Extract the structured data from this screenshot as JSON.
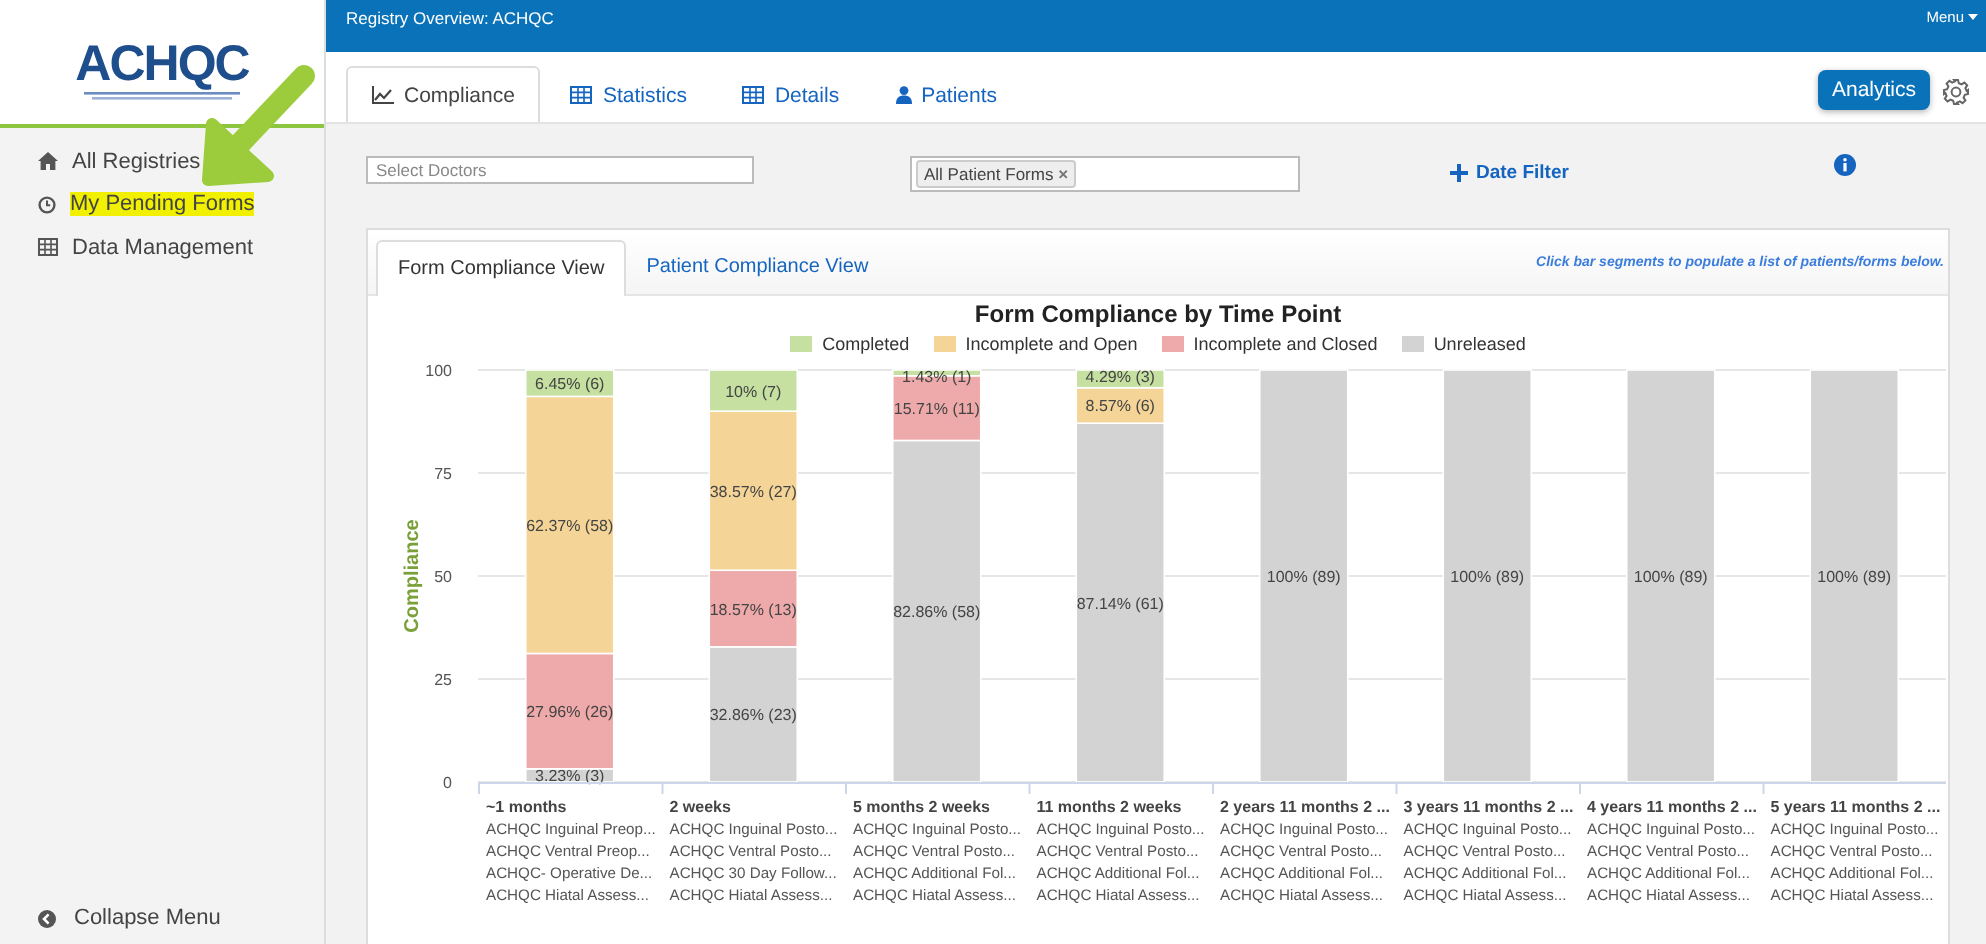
{
  "sidebar": {
    "logo": "ACHQC",
    "items": [
      {
        "label": "All Registries",
        "highlighted": false
      },
      {
        "label": "My Pending Forms",
        "highlighted": true
      },
      {
        "label": "Data Management",
        "highlighted": false
      }
    ],
    "collapse": "Collapse Menu"
  },
  "header": {
    "title": "Registry Overview: ACHQC",
    "menu": "Menu"
  },
  "tabs": [
    {
      "label": "Compliance",
      "selected": true
    },
    {
      "label": "Statistics",
      "selected": false
    },
    {
      "label": "Details",
      "selected": false
    },
    {
      "label": "Patients",
      "selected": false
    }
  ],
  "analytics_button": "Analytics",
  "filters": {
    "doctors_placeholder": "Select Doctors",
    "forms_tag": "All Patient Forms",
    "tag_remove": "×",
    "date_filter": "Date Filter"
  },
  "view_tabs": [
    {
      "label": "Form Compliance View",
      "selected": true
    },
    {
      "label": "Patient Compliance View",
      "selected": false
    }
  ],
  "hint": "Click bar segments to populate a list of patients/forms below.",
  "chart_data": {
    "type": "bar",
    "stacked": true,
    "title": "Form Compliance by Time Point",
    "ylabel": "Compliance",
    "ylim": [
      0,
      100
    ],
    "yticks": [
      0,
      25,
      50,
      75,
      100
    ],
    "grid": true,
    "legend": true,
    "categories": [
      "~1 months",
      "2 weeks",
      "5 months 2 weeks",
      "11 months 2 weeks",
      "2 years 11 months 2 ...",
      "3 years 11 months 2 ...",
      "4 years 11 months 2 ...",
      "5 years 11 months 2 ..."
    ],
    "data_labels": "value_labels",
    "series": [
      {
        "name": "Unreleased",
        "color": "#d3d3d3",
        "values": [
          3.2,
          32.8,
          82.9,
          87.1,
          100,
          100,
          100,
          100
        ]
      },
      {
        "name": "Incomplete and Closed",
        "color": "#eeaaaa",
        "values": [
          28,
          18.6,
          15.7,
          0,
          0,
          0,
          0,
          0
        ]
      },
      {
        "name": "Incomplete and Open",
        "color": "#f5d597",
        "values": [
          62.4,
          38.6,
          0,
          8.6,
          0,
          0,
          0,
          0
        ]
      },
      {
        "name": "Completed",
        "color": "#c5e0a0",
        "values": [
          6.4,
          10,
          1.4,
          4.3,
          0,
          0,
          0,
          0
        ]
      }
    ]
  },
  "segment_labels": [
    [
      "6.45% (6)",
      "62.37% (58)",
      "27.96% (26)",
      "3.23% (3)"
    ],
    [
      "10% (7)",
      "38.57% (27)",
      "18.57% (13)",
      "32.86% (23)"
    ],
    [
      "1.43% (1)",
      "15.71% (11)",
      "82.86% (58)"
    ],
    [
      "4.29% (3)",
      "8.57% (6)",
      "87.14% (61)"
    ],
    [
      "100% (89)"
    ],
    [
      "100% (89)"
    ],
    [
      "100% (89)"
    ],
    [
      "100% (89)"
    ]
  ],
  "timepoint_forms": [
    [
      "ACHQC Inguinal Preop...",
      "ACHQC Ventral Preop...",
      "ACHQC- Operative De...",
      "ACHQC Hiatal Assess..."
    ],
    [
      "ACHQC Inguinal Posto...",
      "ACHQC Ventral Posto...",
      "ACHQC 30 Day Follow...",
      "ACHQC Hiatal Assess..."
    ],
    [
      "ACHQC Inguinal Posto...",
      "ACHQC Ventral Posto...",
      "ACHQC Additional Fol...",
      "ACHQC Hiatal Assess..."
    ],
    [
      "ACHQC Inguinal Posto...",
      "ACHQC Ventral Posto...",
      "ACHQC Additional Fol...",
      "ACHQC Hiatal Assess..."
    ],
    [
      "ACHQC Inguinal Posto...",
      "ACHQC Ventral Posto...",
      "ACHQC Additional Fol...",
      "ACHQC Hiatal Assess..."
    ],
    [
      "ACHQC Inguinal Posto...",
      "ACHQC Ventral Posto...",
      "ACHQC Additional Fol...",
      "ACHQC Hiatal Assess..."
    ],
    [
      "ACHQC Inguinal Posto...",
      "ACHQC Ventral Posto...",
      "ACHQC Additional Fol...",
      "ACHQC Hiatal Assess..."
    ],
    [
      "ACHQC Inguinal Posto...",
      "ACHQC Ventral Posto...",
      "ACHQC Additional Fol...",
      "ACHQC Hiatal Assess..."
    ]
  ]
}
